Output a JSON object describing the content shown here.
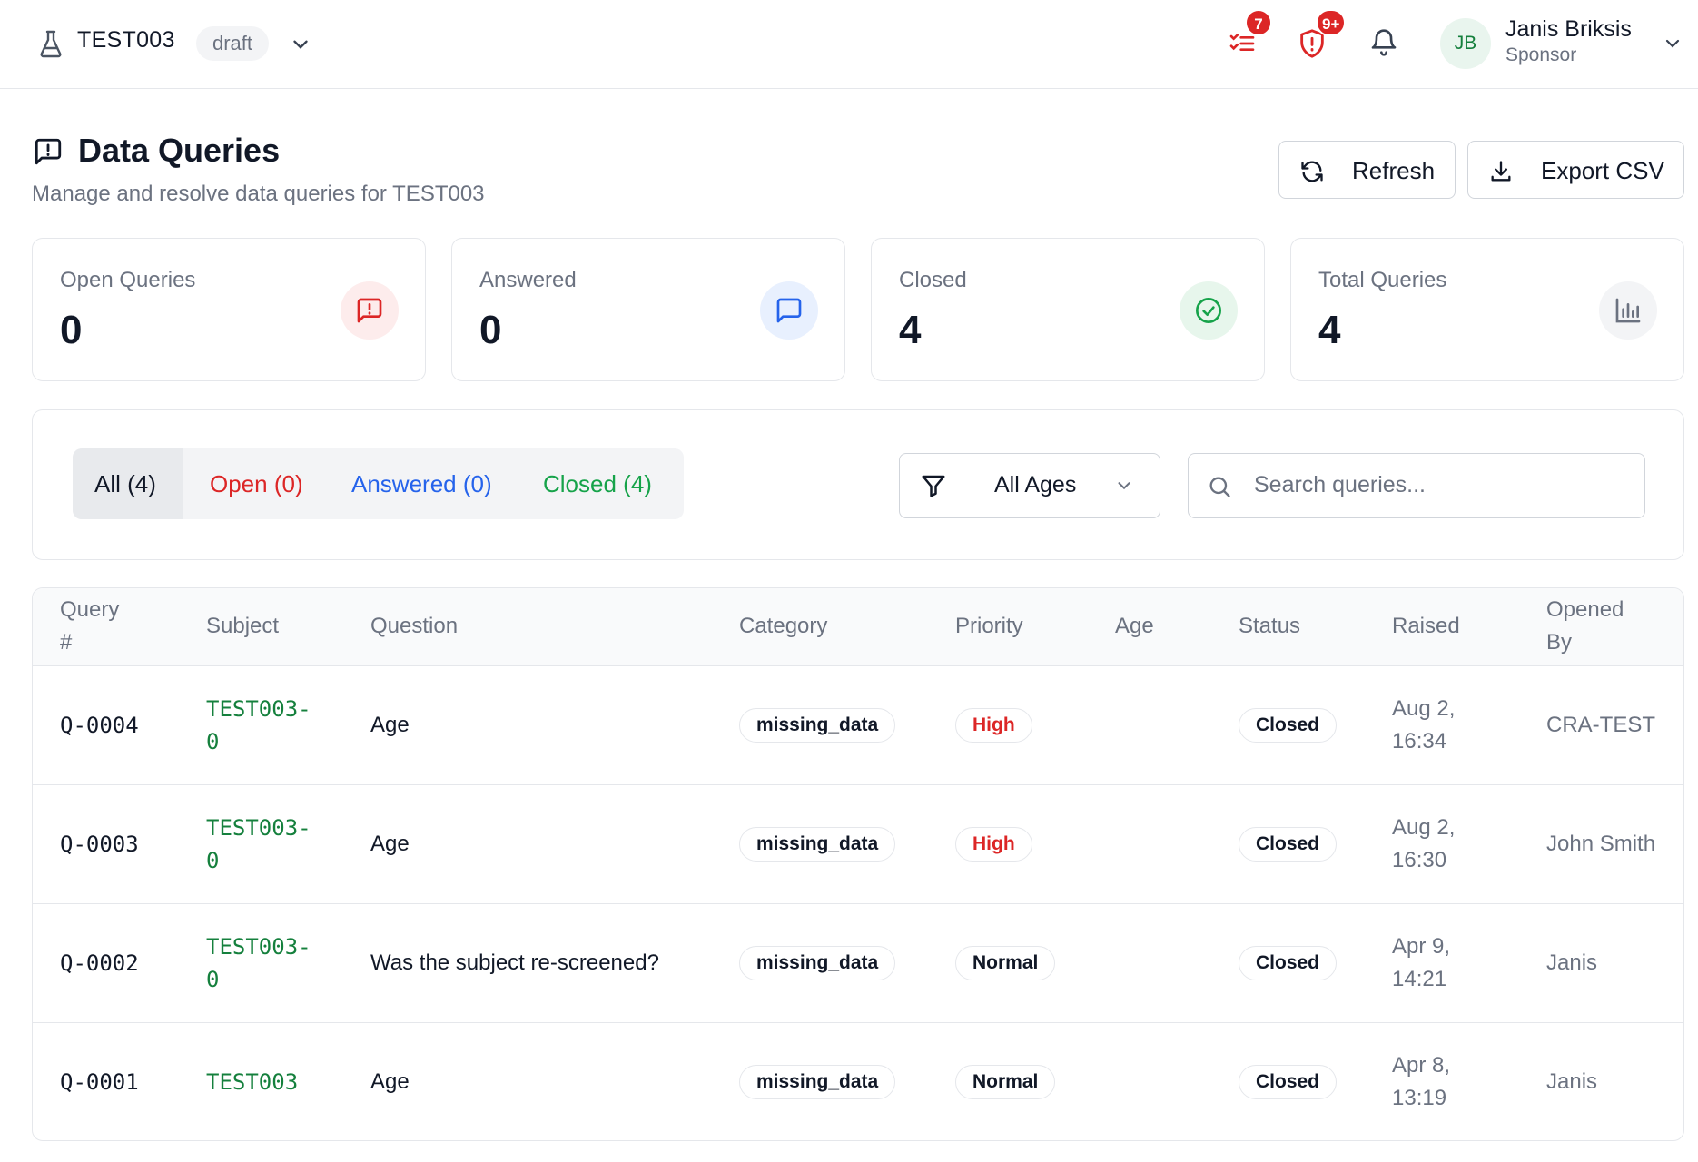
{
  "header": {
    "study_name": "TEST003",
    "study_status": "draft",
    "tasks_badge": "7",
    "alerts_badge": "9+",
    "user": {
      "initials": "JB",
      "name": "Janis Briksis",
      "role": "Sponsor"
    }
  },
  "page": {
    "title": "Data Queries",
    "subtitle": "Manage and resolve data queries for TEST003",
    "refresh_label": "Refresh",
    "export_label": "Export CSV"
  },
  "stats": [
    {
      "label": "Open Queries",
      "value": "0",
      "icon": "alert-message-icon",
      "color": "#dc2626",
      "bg": "#fdecec"
    },
    {
      "label": "Answered",
      "value": "0",
      "icon": "message-icon",
      "color": "#2563eb",
      "bg": "#e8f0fe"
    },
    {
      "label": "Closed",
      "value": "4",
      "icon": "check-circle-icon",
      "color": "#16a34a",
      "bg": "#e7f6ec"
    },
    {
      "label": "Total Queries",
      "value": "4",
      "icon": "bar-chart-icon",
      "color": "#6b7280",
      "bg": "#f3f4f6"
    }
  ],
  "filters": {
    "tabs": [
      {
        "label": "All (4)",
        "color": "#111827"
      },
      {
        "label": "Open (0)",
        "color": "#dc2626"
      },
      {
        "label": "Answered (0)",
        "color": "#2563eb"
      },
      {
        "label": "Closed (4)",
        "color": "#16a34a"
      }
    ],
    "age_value": "All Ages",
    "search_placeholder": "Search queries..."
  },
  "table": {
    "columns": {
      "query_line1": "Query",
      "query_line2": "#",
      "subject": "Subject",
      "question": "Question",
      "category": "Category",
      "priority": "Priority",
      "age": "Age",
      "status": "Status",
      "raised": "Raised",
      "opened_line1": "Opened",
      "opened_line2": "By"
    },
    "rows": [
      {
        "id": "Q-0004",
        "subject_l1": "TEST003-",
        "subject_l2": "0",
        "question": "Age",
        "category": "missing_data",
        "priority": "High",
        "status": "Closed",
        "raised_l1": "Aug 2,",
        "raised_l2": "16:34",
        "opened_by": "CRA-TEST"
      },
      {
        "id": "Q-0003",
        "subject_l1": "TEST003-",
        "subject_l2": "0",
        "question": "Age",
        "category": "missing_data",
        "priority": "High",
        "status": "Closed",
        "raised_l1": "Aug 2,",
        "raised_l2": "16:30",
        "opened_by": "John Smith"
      },
      {
        "id": "Q-0002",
        "subject_l1": "TEST003-",
        "subject_l2": "0",
        "question": "Was the subject re-screened?",
        "category": "missing_data",
        "priority": "Normal",
        "status": "Closed",
        "raised_l1": "Apr 9,",
        "raised_l2": "14:21",
        "opened_by": "Janis"
      },
      {
        "id": "Q-0001",
        "subject_l1": "TEST003",
        "subject_l2": "",
        "question": "Age",
        "category": "missing_data",
        "priority": "Normal",
        "status": "Closed",
        "raised_l1": "Apr 8,",
        "raised_l2": "13:19",
        "opened_by": "Janis"
      }
    ]
  },
  "colors": {
    "subject_link": "#15803d",
    "priority_high": "#dc2626",
    "priority_normal": "#111827"
  }
}
